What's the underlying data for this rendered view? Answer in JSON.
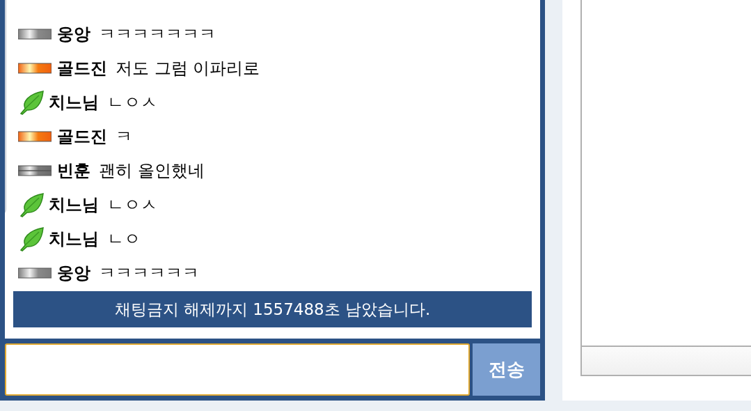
{
  "chat": {
    "messages": [
      {
        "kind": "gray",
        "name": "웅앙",
        "text": "ㅋㅋㅋㅋㅋㅋㅋ"
      },
      {
        "kind": "gold",
        "name": "골드진",
        "text": "저도 그럼 이파리로"
      },
      {
        "kind": "leaf",
        "name": "치느님",
        "text": "ㄴㅇㅅ"
      },
      {
        "kind": "gold",
        "name": "골드진",
        "text": "ㅋ"
      },
      {
        "kind": "gray-double",
        "name": "빈훈",
        "text": "괜히 올인했네"
      },
      {
        "kind": "leaf",
        "name": "치느님",
        "text": "ㄴㅇㅅ"
      },
      {
        "kind": "leaf",
        "name": "치느님",
        "text": "ㄴㅇ"
      },
      {
        "kind": "gray",
        "name": "웅앙",
        "text": "ㅋㅋㅋㅋㅋㅋ"
      }
    ],
    "notice": "채팅금지 해제까지 1557488초 남았습니다.",
    "send_button": "전송"
  }
}
